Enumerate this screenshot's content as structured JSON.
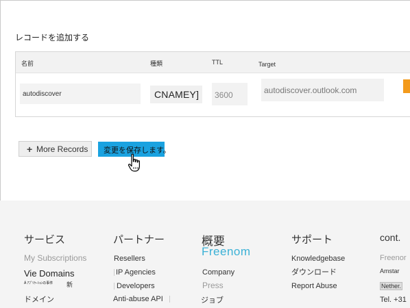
{
  "page": {
    "section_title": "レコードを追加する"
  },
  "records": {
    "headers": {
      "name": "名前",
      "type": "種類",
      "ttl": "TTL",
      "target": "Target"
    },
    "row": {
      "name": "autodiscover",
      "type": "CNAMEY]",
      "ttl": "3600",
      "target": "autodiscover.outlook.com"
    }
  },
  "actions": {
    "more_records": "More Records",
    "save_changes": "変更を保存します。"
  },
  "footer": {
    "services": {
      "heading": "サービス",
      "items": [
        "My Subscriptions",
        "Vie Domains",
        "ドメイン"
      ],
      "tiny_text": "Ȃ ｱﾌﾟﾘｹｰｼｮﾝの事件",
      "new_badge": "新"
    },
    "partners": {
      "heading": "パートナー",
      "items": [
        "Resellers",
        "IP Agencies",
        "Developers",
        "Anti-abuse API"
      ]
    },
    "about": {
      "heading": "概要",
      "brand": "Freenom",
      "items": [
        "Company",
        "Press",
        "ジョブ"
      ]
    },
    "support": {
      "heading": "サポート",
      "items": [
        "Knowledgebase",
        "ダウンロード",
        "Report Abuse"
      ]
    },
    "contact": {
      "heading": "cont.",
      "items": [
        "Freenor",
        "Amstar",
        "Nether.",
        "Tel. +31"
      ]
    }
  },
  "colors": {
    "save_button": "#1aa2e0",
    "accent_orange": "#f39a1b",
    "brand_blue": "#3bb1d6",
    "footer_bg": "#f4f4f4"
  }
}
